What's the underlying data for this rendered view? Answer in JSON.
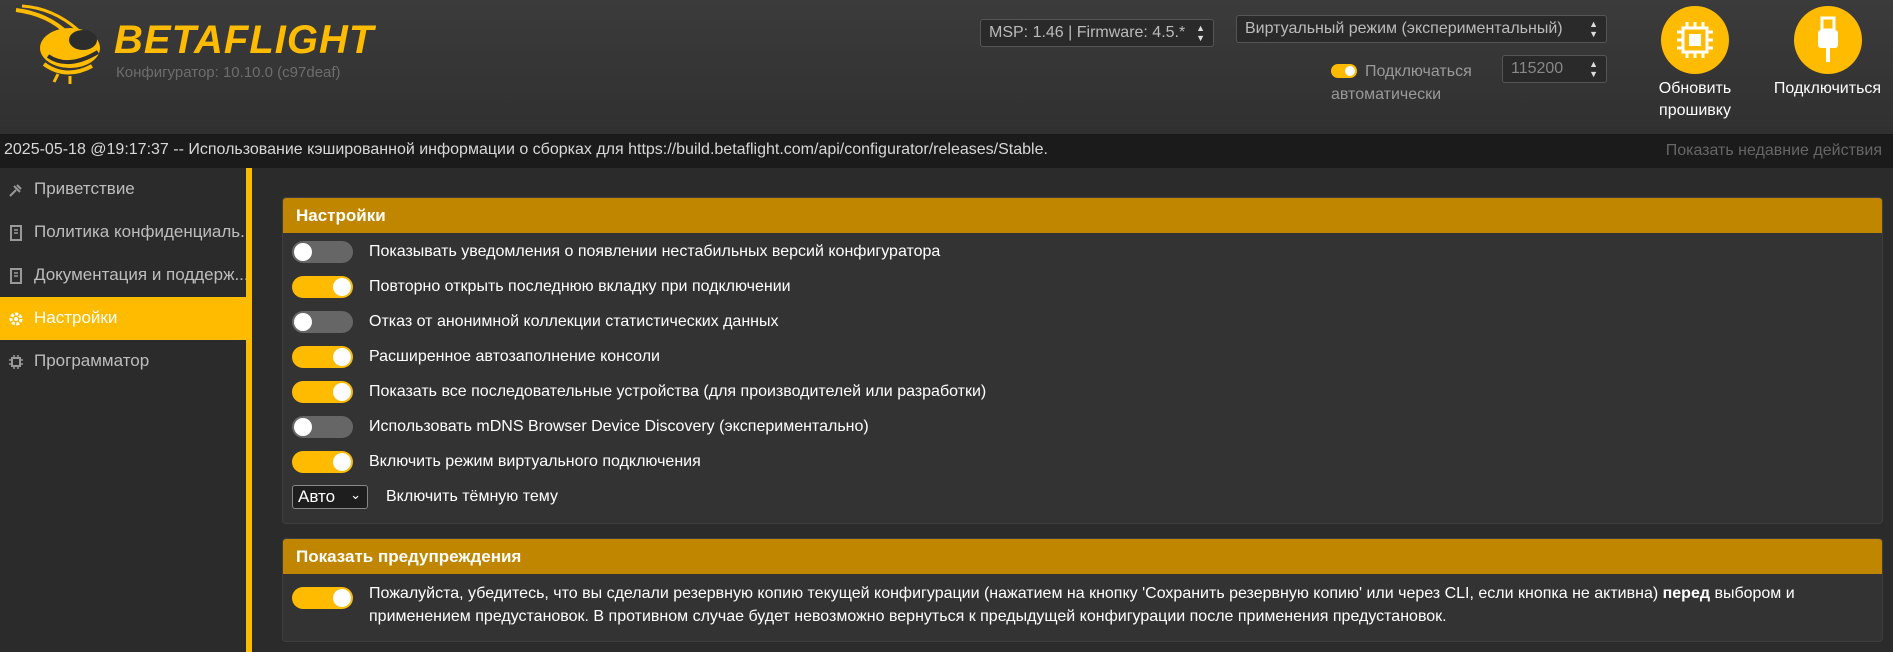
{
  "header": {
    "logo": {
      "word_a": "BETA",
      "word_b": "FLIGHT"
    },
    "subtitle": "Конфигуратор: 10.10.0 (c97deaf)",
    "msp_select": "MSP: 1.46 | Firmware: 4.5.*",
    "mode_select": "Виртуальный режим (экспериментальный)",
    "auto_connect": {
      "label": "Подключаться автоматически",
      "enabled": true
    },
    "baud_select": "115200",
    "firmware_button": {
      "label": "Обновить прошивку",
      "icon": "chip-icon"
    },
    "connect_button": {
      "label": "Подключиться",
      "icon": "usb-icon"
    }
  },
  "status_bar": {
    "message": "2025-05-18 @19:17:37 -- Использование кэшированной информации о сборках для https://build.betaflight.com/api/configurator/releases/Stable.",
    "recent_actions": "Показать недавние действия"
  },
  "sidebar": {
    "items": [
      {
        "label": "Приветствие",
        "icon": "plug-icon",
        "active": false
      },
      {
        "label": "Политика конфиденциаль...",
        "icon": "book-icon",
        "active": false
      },
      {
        "label": "Документация и поддерж...",
        "icon": "book-icon",
        "active": false
      },
      {
        "label": "Настройки",
        "icon": "gear-icon",
        "active": true
      },
      {
        "label": "Программатор",
        "icon": "chip-icon",
        "active": false
      }
    ]
  },
  "settings_panel": {
    "title": "Настройки",
    "options": [
      {
        "label": "Показывать уведомления о появлении нестабильных версий конфигуратора",
        "enabled": false
      },
      {
        "label": "Повторно открыть последнюю вкладку при подключении",
        "enabled": true
      },
      {
        "label": "Отказ от анонимной коллекции статистических данных",
        "enabled": false
      },
      {
        "label": "Расширенное автозаполнение консоли",
        "enabled": true
      },
      {
        "label": "Показать все последовательные устройства (для производителей или разработки)",
        "enabled": true
      },
      {
        "label": "Использовать mDNS Browser Device Discovery (экспериментально)",
        "enabled": false
      },
      {
        "label": "Включить режим виртуального подключения",
        "enabled": true
      }
    ],
    "theme": {
      "value": "Авто",
      "label": "Включить тёмную тему"
    }
  },
  "warnings_panel": {
    "title": "Показать предупреждения",
    "enabled": true,
    "text_before": "Пожалуйста, убедитесь, что вы сделали резервную копию текущей конфигурации (нажатием на кнопку 'Сохранить резервную копию' или через CLI, если кнопка не активна) ",
    "text_bold": "перед",
    "text_after": " выбором и применением предустановок. В противном случае будет невозможно вернуться к предыдущей конфигурации после применения предустановок."
  },
  "colors": {
    "accent": "#ffbb00",
    "panel_header": "#c08600",
    "background": "#2b2b2b"
  }
}
